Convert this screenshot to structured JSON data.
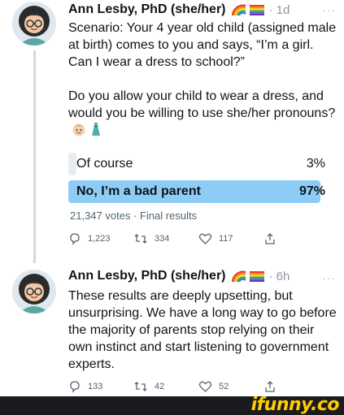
{
  "tweet1": {
    "author": "Ann Lesby, PhD (she/her)",
    "time": "· 1d",
    "more": "···",
    "text_p1": "Scenario: Your 4 year old child (assigned male at birth) comes to you and says, “I’m a girl. Can I wear a dress to school?”",
    "text_p2": "Do you allow your child to wear a dress, and would you be willing to use she/her pronouns?",
    "poll": {
      "options": [
        {
          "label": "Of course",
          "percent_label": "3%",
          "value": 3
        },
        {
          "label": "No, I’m a bad parent",
          "percent_label": "97%",
          "value": 97
        }
      ],
      "meta": "21,347 votes · Final results"
    },
    "actions": {
      "replies": "1,223",
      "retweets": "334",
      "likes": "117"
    }
  },
  "tweet2": {
    "author": "Ann Lesby, PhD (she/her)",
    "time": "· 6h",
    "more": "···",
    "text": "These results are deeply upsetting, but unsurprising. We have a long way to go before the majority of parents stop relying on their own instinct and start listening to government experts.",
    "actions": {
      "replies": "133",
      "retweets": "42",
      "likes": "52"
    }
  },
  "watermark": "ifunny.co",
  "icons": [
    "avatar-face-icon",
    "rainbow-icon",
    "pride-flag-icon",
    "boy-face-icon",
    "dress-icon",
    "reply-icon",
    "retweet-icon",
    "like-icon",
    "share-icon"
  ],
  "colors": {
    "poll_winner": "#8dcdf5",
    "poll_other": "#e6ecf0",
    "muted": "#536471",
    "watermark_bg": "#1b1b1f",
    "watermark_text": "#ffcc00"
  }
}
